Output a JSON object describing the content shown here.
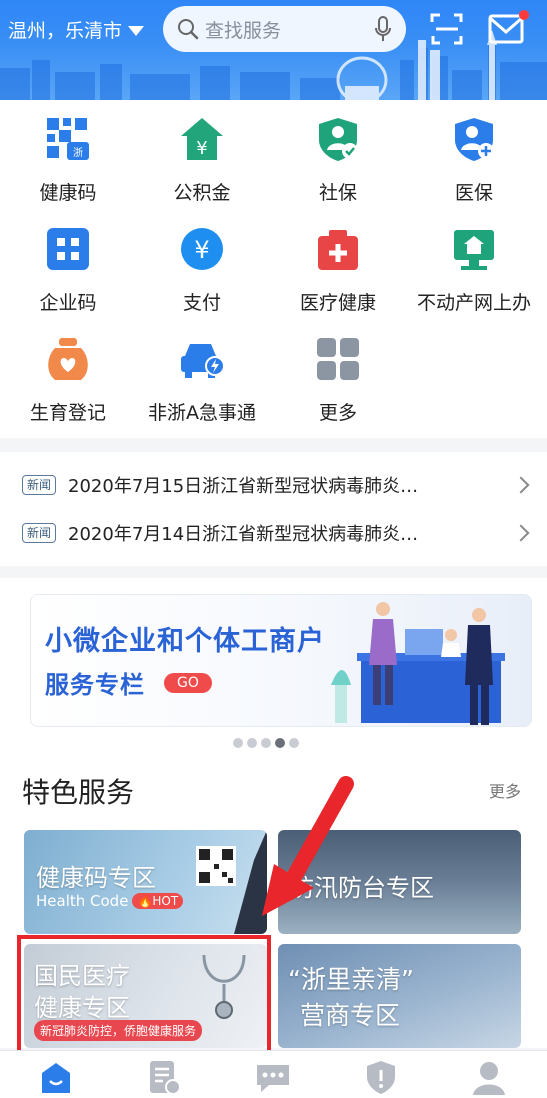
{
  "header": {
    "location": "温州，乐清市",
    "search_placeholder": "查找服务"
  },
  "grid": [
    {
      "label": "健康码",
      "icon": "health-code-icon"
    },
    {
      "label": "公积金",
      "icon": "housing-fund-icon"
    },
    {
      "label": "社保",
      "icon": "social-security-icon"
    },
    {
      "label": "医保",
      "icon": "medical-insurance-icon"
    },
    {
      "label": "企业码",
      "icon": "enterprise-code-icon"
    },
    {
      "label": "支付",
      "icon": "payment-icon"
    },
    {
      "label": "医疗健康",
      "icon": "medical-health-icon"
    },
    {
      "label": "不动产网上办",
      "icon": "real-estate-icon"
    },
    {
      "label": "生育登记",
      "icon": "birth-registration-icon"
    },
    {
      "label": "非浙A急事通",
      "icon": "car-service-icon"
    },
    {
      "label": "更多",
      "icon": "more-grid-icon"
    }
  ],
  "news": [
    {
      "tag": "新闻",
      "text": "2020年7月15日浙江省新型冠状病毒肺炎…"
    },
    {
      "tag": "新闻",
      "text": "2020年7月14日浙江省新型冠状病毒肺炎…"
    }
  ],
  "banner": {
    "line1": "小微企业和个体工商户",
    "line2": "服务专栏",
    "go": "GO",
    "pages": 5,
    "active_page": 4
  },
  "featured": {
    "title": "特色服务",
    "more": "更多",
    "tiles": [
      {
        "title": "健康码专区",
        "sub": "Health Code",
        "badge": "HOT"
      },
      {
        "title": "防汛防台专区"
      },
      {
        "title1": "国民医疗",
        "title2": "健康专区",
        "sub": "新冠肺炎防控，侨胞健康服务"
      },
      {
        "title1": "“浙里亲清”",
        "title2": "营商专区"
      }
    ]
  }
}
